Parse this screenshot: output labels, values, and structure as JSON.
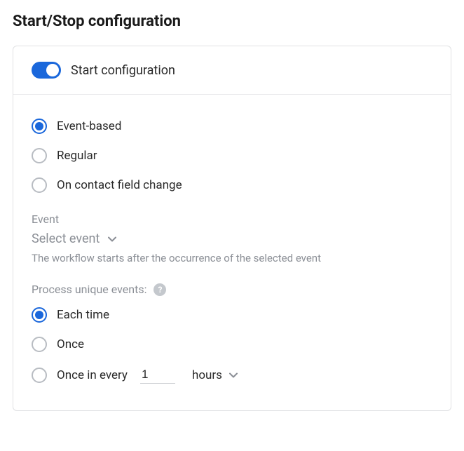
{
  "title": "Start/Stop configuration",
  "header": {
    "toggle_on": true,
    "label": "Start configuration"
  },
  "trigger_type": {
    "options": [
      {
        "key": "event-based",
        "label": "Event-based",
        "selected": true
      },
      {
        "key": "regular",
        "label": "Regular",
        "selected": false
      },
      {
        "key": "on-contact-field-change",
        "label": "On contact field change",
        "selected": false
      }
    ]
  },
  "event": {
    "label": "Event",
    "placeholder": "Select event",
    "helper": "The workflow starts after the occurrence of the selected event"
  },
  "process": {
    "label": "Process unique events:",
    "options": [
      {
        "key": "each-time",
        "label": "Each time",
        "selected": true
      },
      {
        "key": "once",
        "label": "Once",
        "selected": false
      },
      {
        "key": "once-in-every",
        "label": "Once in every",
        "selected": false,
        "value": "1",
        "unit": "hours"
      }
    ]
  }
}
